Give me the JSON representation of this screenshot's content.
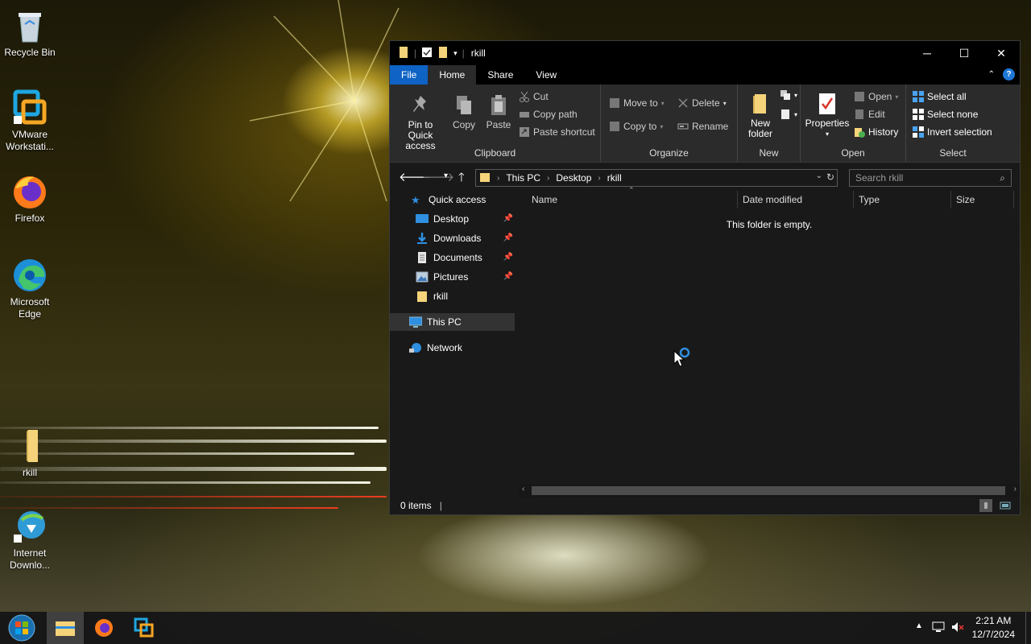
{
  "desktop": {
    "icons": [
      {
        "label": "Recycle Bin"
      },
      {
        "label": "VMware Workstati..."
      },
      {
        "label": "Firefox"
      },
      {
        "label": "Microsoft Edge"
      },
      {
        "label": "rkill"
      },
      {
        "label": "Internet Downlo..."
      }
    ]
  },
  "window": {
    "title": "rkill",
    "controls": {
      "minimize": "─",
      "maximize": "☐",
      "close": "✕"
    },
    "tabs": {
      "file": "File",
      "home": "Home",
      "share": "Share",
      "view": "View"
    },
    "help": "?",
    "ribbon": {
      "clipboard": {
        "label": "Clipboard",
        "pin": "Pin to Quick access",
        "copy": "Copy",
        "paste": "Paste",
        "cut": "Cut",
        "copy_path": "Copy path",
        "paste_shortcut": "Paste shortcut"
      },
      "organize": {
        "label": "Organize",
        "move_to": "Move to",
        "copy_to": "Copy to",
        "delete": "Delete",
        "rename": "Rename"
      },
      "new": {
        "label": "New",
        "new_folder": "New folder"
      },
      "open": {
        "label": "Open",
        "properties": "Properties",
        "open": "Open",
        "edit": "Edit",
        "history": "History"
      },
      "select": {
        "label": "Select",
        "select_all": "Select all",
        "select_none": "Select none",
        "invert_selection": "Invert selection"
      }
    },
    "address": {
      "crumbs": [
        "This PC",
        "Desktop",
        "rkill"
      ],
      "search_placeholder": "Search rkill"
    },
    "nav": {
      "quick_access": "Quick access",
      "items": [
        {
          "label": "Desktop",
          "pinned": true
        },
        {
          "label": "Downloads",
          "pinned": true
        },
        {
          "label": "Documents",
          "pinned": true
        },
        {
          "label": "Pictures",
          "pinned": true
        },
        {
          "label": "rkill",
          "pinned": false
        }
      ],
      "this_pc": "This PC",
      "network": "Network"
    },
    "columns": [
      "Name",
      "Date modified",
      "Type",
      "Size"
    ],
    "empty_message": "This folder is empty.",
    "status": "0 items"
  },
  "taskbar": {
    "time": "2:21 AM",
    "date": "12/7/2024"
  },
  "colors": {
    "accent": "#0f63c4",
    "window_bg": "#191919",
    "ribbon_bg": "#2b2b2b",
    "titlebar_bg": "#000000"
  }
}
